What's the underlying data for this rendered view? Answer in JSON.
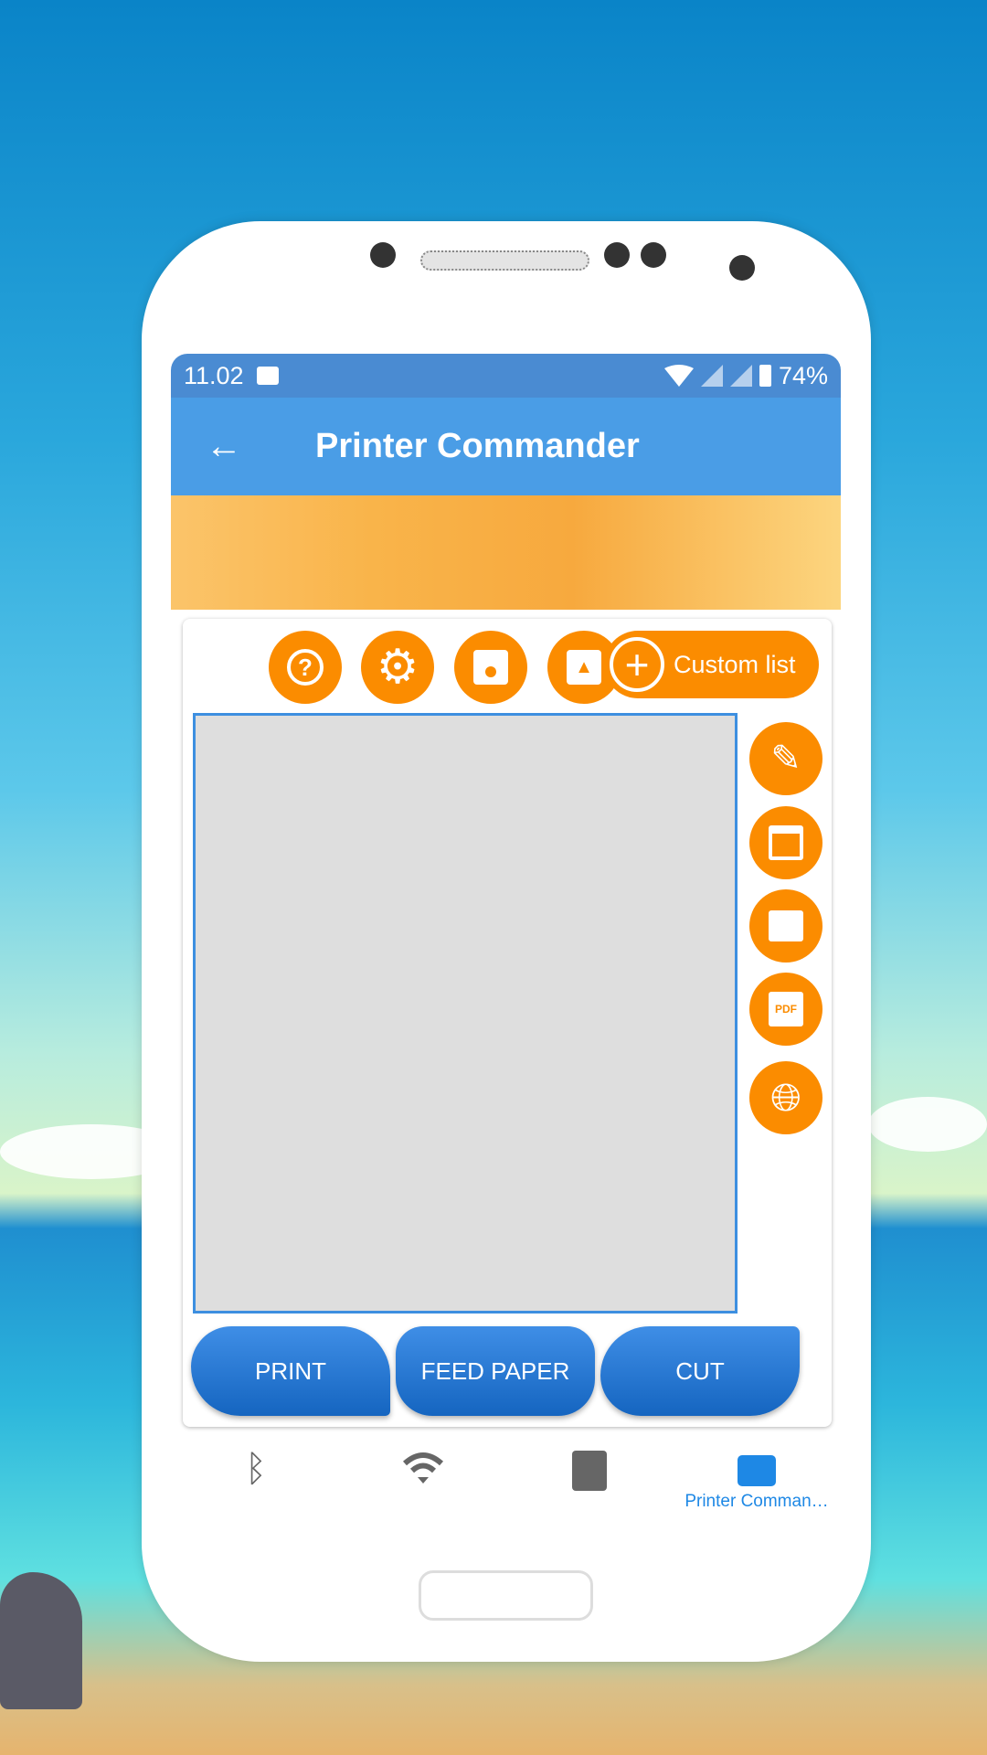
{
  "status_bar": {
    "time": "11.02",
    "battery": "74%"
  },
  "app_bar": {
    "title": "Printer Commander"
  },
  "toolbar": {
    "custom_list_label": "Custom list"
  },
  "side_tools": [
    "edit",
    "calendar",
    "image",
    "pdf",
    "web"
  ],
  "actions": {
    "print": "PRINT",
    "feed_paper": "FEED PAPER",
    "cut": "CUT"
  },
  "bottom_nav": [
    {
      "icon": "bluetooth-icon",
      "label": ""
    },
    {
      "icon": "wifi-icon",
      "label": ""
    },
    {
      "icon": "notes-icon",
      "label": ""
    },
    {
      "icon": "printer-icon",
      "label": "Printer Comman…",
      "active": true
    }
  ],
  "colors": {
    "accent": "#fb8c00",
    "primary": "#4a9de6",
    "button": "#1e6fd0"
  }
}
